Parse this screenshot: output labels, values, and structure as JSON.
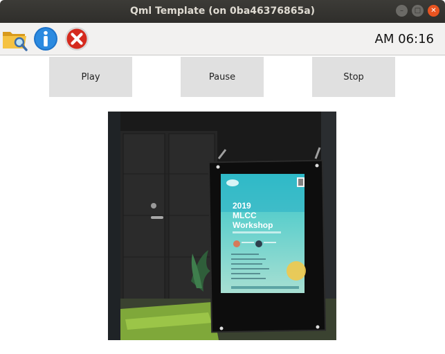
{
  "window": {
    "title": "Qml Template (on 0ba46376865a)",
    "controls": [
      "minimize",
      "maximize",
      "close"
    ]
  },
  "toolbar": {
    "tools": [
      {
        "icon": "folder-search-icon"
      },
      {
        "icon": "info-icon"
      },
      {
        "icon": "close-red-icon"
      }
    ],
    "clock": "AM 06:16"
  },
  "controls": {
    "play_label": "Play",
    "pause_label": "Pause",
    "stop_label": "Stop"
  },
  "video": {
    "poster_lines": [
      "2019",
      "MLCC",
      "Workshop"
    ],
    "poster_colors": {
      "top": "#35c6c9",
      "bottom": "#a7dfd2"
    }
  }
}
